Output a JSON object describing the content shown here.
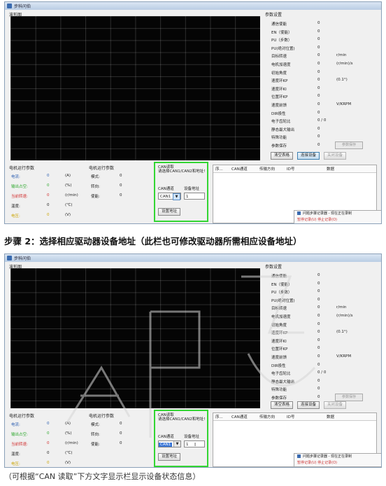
{
  "window": {
    "title": "步科问伯"
  },
  "wave_label": "波形图",
  "params": {
    "title": "参数设置",
    "rows": [
      {
        "label": "通信使能",
        "value": "0",
        "unit": ""
      },
      {
        "label": "EN（使能）",
        "value": "0",
        "unit": ""
      },
      {
        "label": "PU（步数）",
        "value": "0",
        "unit": ""
      },
      {
        "label": "PU(绝对位置)",
        "value": "0",
        "unit": ""
      },
      {
        "label": "目标转速",
        "value": "0",
        "unit": "r/min"
      },
      {
        "label": "电机加速度",
        "value": "0",
        "unit": "(r/min)/s"
      },
      {
        "label": "初始角度",
        "value": "0",
        "unit": ""
      },
      {
        "label": "速度环KP",
        "value": "0",
        "unit": "(0.1°)"
      },
      {
        "label": "速度环KI",
        "value": "0",
        "unit": ""
      },
      {
        "label": "位置环KP",
        "value": "0",
        "unit": ""
      },
      {
        "label": "速度前馈",
        "value": "0",
        "unit": "V/KRPM"
      },
      {
        "label": "DIR极性",
        "value": "0",
        "unit": ""
      },
      {
        "label": "电子齿轮比",
        "value": "0  /  0",
        "unit": ""
      },
      {
        "label": "静态最大输出",
        "value": "0",
        "unit": ""
      },
      {
        "label": "特殊功能",
        "value": "0",
        "unit": ""
      },
      {
        "label": "参数保存",
        "value": "0",
        "unit": ""
      }
    ],
    "param_save_button": "参数保存"
  },
  "buttons": {
    "clear_table": "清空表格",
    "connect": "连接设备",
    "disconnect": "关闭设备"
  },
  "motor_params_left": {
    "title": "电机运行参数",
    "rows": [
      {
        "label": "电流:",
        "value": "0",
        "unit": "(A)",
        "color": "#2a5db0"
      },
      {
        "label": "输出占空:",
        "value": "0",
        "unit": "(%)",
        "color": "#2ea82e"
      },
      {
        "label": "当前转速:",
        "value": "0",
        "unit": "(r/min)",
        "color": "#d03030"
      },
      {
        "label": "温度:",
        "value": "0",
        "unit": "(℃)",
        "color": "#222222"
      },
      {
        "label": "电压:",
        "value": "0",
        "unit": "(V)",
        "color": "#caa400"
      }
    ]
  },
  "motor_params_mid": {
    "title": "电机运行参数",
    "rows": [
      {
        "label": "模式:",
        "value": "0"
      },
      {
        "label": "转向:",
        "value": "0"
      },
      {
        "label": "使能:",
        "value": "0"
      }
    ]
  },
  "can": {
    "title": "CAN读取",
    "hint_top": "请选择CAN1/CAN2和地址!",
    "hint_bottom": "请选择CAN1/CAN2和地址!",
    "channel_label": "CAN通道",
    "address_label": "设备地址",
    "channel_value": "CAN1",
    "address_value": "1",
    "set_address_button": "设置地址"
  },
  "log_columns": [
    "序...",
    "CAN通道",
    "传输方向",
    "ID号",
    "数据"
  ],
  "popup": {
    "line1": "问题步骤记录器 - 现在正在录制",
    "line2": "暂停记录(U)   停止记录(O)"
  },
  "captions": {
    "step2": "步骤 2：选择相应驱动器设备地址（此栏也可修改驱动器所需相应设备地址）",
    "note": "（可根据“CAN 读取”下方文字显示栏显示设备状态信息）"
  }
}
